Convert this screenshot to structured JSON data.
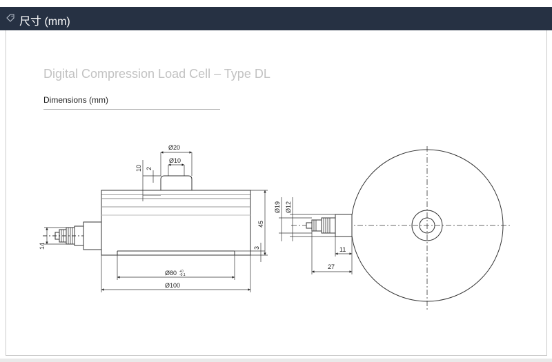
{
  "header": {
    "title": "尺寸 (mm)",
    "icon": "tag-icon",
    "background": "#263143"
  },
  "panel": {
    "title": "Digital Compression Load Cell – Type DL",
    "subtitle": "Dimensions (mm)"
  },
  "dimensions": {
    "top_button_diameter": "Ø20",
    "inner_button_diameter": "Ø10",
    "button_height": "10",
    "button_step": "2",
    "total_height": "45",
    "base_recess": "3",
    "cable_gland_height": "14",
    "base_diameter": "Ø80",
    "base_tolerance_upper": "+0",
    "base_tolerance_lower": "-0.1",
    "body_diameter": "Ø100",
    "connector_diameter_outer": "Ø19",
    "connector_diameter_inner": "Ø12",
    "connector_offset": "11",
    "connector_length": "27"
  }
}
